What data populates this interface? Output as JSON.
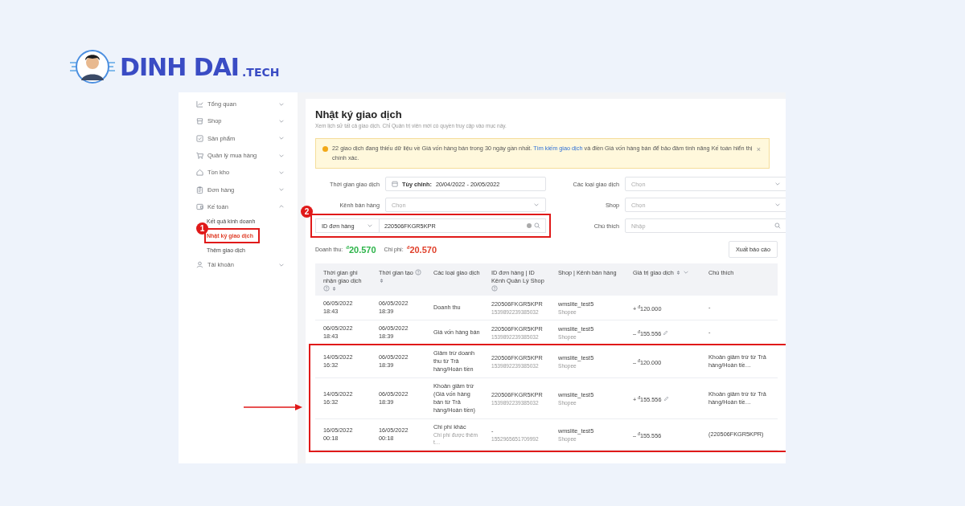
{
  "logo": {
    "name": "DINH DAI",
    "suffix": ".TECH"
  },
  "sidebar": {
    "items": [
      {
        "label": "Tổng quan",
        "expanded": false
      },
      {
        "label": "Shop",
        "expanded": false
      },
      {
        "label": "Sản phẩm",
        "expanded": false
      },
      {
        "label": "Quản lý mua hàng",
        "expanded": false
      },
      {
        "label": "Tồn kho",
        "expanded": false
      },
      {
        "label": "Đơn hàng",
        "expanded": false
      },
      {
        "label": "Kế toán",
        "expanded": true,
        "children": [
          {
            "label": "Kết quả kinh doanh",
            "selected": false
          },
          {
            "label": "Nhật ký giao dịch",
            "selected": true,
            "badge": "1"
          },
          {
            "label": "Thêm giao dịch",
            "selected": false
          }
        ]
      },
      {
        "label": "Tài khoản",
        "expanded": false
      }
    ]
  },
  "page": {
    "title": "Nhật ký giao dịch",
    "subtitle": "Xem lịch sử tất cả giao dịch. Chỉ Quản trị viên mới có quyền truy cập vào mục này."
  },
  "alert": {
    "text": "22 giao dịch đang thiếu dữ liệu về Giá vốn hàng bán trong 30 ngày gần nhất.",
    "link": "Tìm kiếm giao dịch",
    "text_after": "và điền Giá vốn hàng bán để bảo đảm tính năng Kế toán hiển thị chính xác.",
    "close": "×"
  },
  "filters": [
    {
      "kind": "date",
      "label": "Thời gian giao dịch",
      "prefix": "Tùy chỉnh:",
      "value": "20/04/2022 - 20/05/2022"
    },
    {
      "kind": "select",
      "label": "Các loại giao dịch",
      "placeholder": "Chọn"
    },
    {
      "kind": "select",
      "label": "Kênh bán hàng",
      "placeholder": "Chọn"
    },
    {
      "kind": "select",
      "label": "Shop",
      "placeholder": "Chọn"
    },
    {
      "kind": "search-select",
      "select": "ID đơn hàng",
      "value": "220506FKGR5KPR",
      "badge": "2"
    },
    {
      "kind": "search",
      "label": "Chú thích",
      "placeholder": "Nhập"
    }
  ],
  "summary": {
    "revenue_label": "Doanh thu:",
    "revenue": "$^{đ}$20.570",
    "cost_label": "Chi phí:",
    "cost": "$^{đ}$20.570",
    "export_button": "Xuất báo cáo"
  },
  "table": {
    "columns": [
      {
        "label": "Thời gian ghi nhận giao dịch",
        "help": true,
        "sort": true,
        "filter": false
      },
      {
        "label": "Thời gian tạo",
        "help": true,
        "sort": true,
        "filter": false
      },
      {
        "label": "Các loại giao dịch",
        "help": false,
        "sort": false,
        "filter": false
      },
      {
        "label": "ID đơn hàng | ID Kênh Quản Lý Shop",
        "help": true,
        "sort": false,
        "filter": false
      },
      {
        "label": "Shop | Kênh bán hàng",
        "help": false,
        "sort": false,
        "filter": false
      },
      {
        "label": "Giá trị giao dịch",
        "help": false,
        "sort": true,
        "filter": true
      },
      {
        "label": "Chú thích",
        "help": false,
        "sort": false,
        "filter": false
      }
    ],
    "rows": [
      {
        "highlighted": false,
        "recorded": "06/05/2022 18:43",
        "created": "06/05/2022 18:39",
        "type": "Doanh thu",
        "order_id": "220506FKGR5KPR",
        "channel_id": "1539892239385032",
        "shop": "wmslite_test5",
        "channel": "Shopee",
        "value": "+ $^{đ}$120.000",
        "editable": false,
        "note": "-"
      },
      {
        "highlighted": false,
        "recorded": "06/05/2022 18:43",
        "created": "06/05/2022 18:39",
        "type": "Giá vốn hàng bán",
        "order_id": "220506FKGR5KPR",
        "channel_id": "1539892239385032",
        "shop": "wmslite_test5",
        "channel": "Shopee",
        "value": "– $^{đ}$155.556",
        "editable": true,
        "note": "-"
      },
      {
        "highlighted": true,
        "recorded": "14/05/2022 16:32",
        "created": "06/05/2022 18:39",
        "type": "Giảm trừ doanh thu từ Trả hàng/Hoàn tiền",
        "order_id": "220506FKGR5KPR",
        "channel_id": "1539892239385032",
        "shop": "wmslite_test5",
        "channel": "Shopee",
        "value": "– $^{đ}$120.000",
        "editable": false,
        "note": "Khoản giảm trừ từ Trả hàng/Hoàn tiề…"
      },
      {
        "highlighted": true,
        "recorded": "14/05/2022 16:32",
        "created": "06/05/2022 18:39",
        "type": "Khoản giảm trừ (Giá vốn hàng bán từ Trả hàng/Hoàn tiền)",
        "order_id": "220506FKGR5KPR",
        "channel_id": "1539892239385032",
        "shop": "wmslite_test5",
        "channel": "Shopee",
        "value": "+ $^{đ}$155.556",
        "editable": true,
        "note": "Khoản giảm trừ từ Trả hàng/Hoàn tiề…"
      },
      {
        "highlighted": true,
        "recorded": "16/05/2022 00:18",
        "created": "16/05/2022 00:18",
        "type": "Chi phí khác",
        "type_sub": "Chi phí được thêm t…",
        "order_id": "-",
        "channel_id": "1552965651709992",
        "shop": "wmslite_test5",
        "channel": "Shopee",
        "value": "– $^{đ}$155.556",
        "editable": false,
        "note": "(220506FKGR5KPR)"
      }
    ]
  }
}
